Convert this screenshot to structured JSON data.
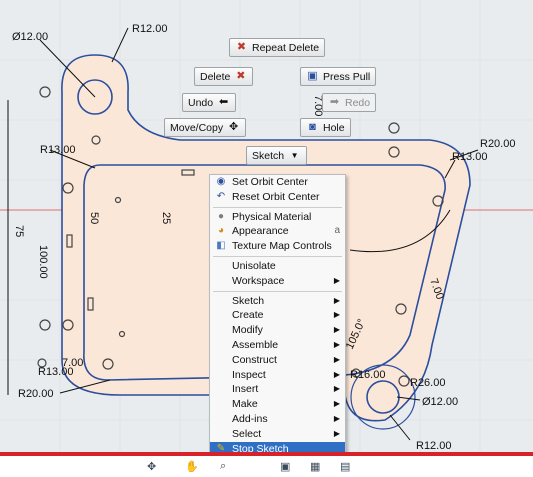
{
  "dimensions": {
    "d_top_circle": "Ø12.00",
    "r_top": "R12.00",
    "r_left_corner": "R13.00",
    "r_right_top": "R20.00",
    "r_right_corner": "R13.00",
    "dim_75": "75",
    "dim_50": "50",
    "dim_25": "25",
    "dim_7_right": "7.00",
    "dim_7_left": "7.00",
    "dim_7_top": "7.00",
    "r_bottom_left": "R13.00",
    "r_bottom_left_outer": "R20.00",
    "angle": "105.0°",
    "r_16": "R16.00",
    "r_26": "R26.00",
    "d_bottom_circle": "Ø12.00",
    "r_bottom": "R12.00",
    "dim_cut": "100.00"
  },
  "marking_menu": {
    "repeat_delete": "Repeat Delete",
    "delete": "Delete",
    "press_pull": "Press Pull",
    "undo": "Undo",
    "redo": "Redo",
    "move_copy": "Move/Copy",
    "hole": "Hole",
    "sketch": "Sketch"
  },
  "context_menu": {
    "groups": [
      [
        {
          "label": "Set Orbit Center",
          "icon": "orbit-center-icon"
        },
        {
          "label": "Reset Orbit Center",
          "icon": "reset-orbit-icon"
        }
      ],
      [
        {
          "label": "Physical Material",
          "icon": "material-sphere-icon"
        },
        {
          "label": "Appearance",
          "icon": "appearance-icon",
          "shortcut": "a"
        },
        {
          "label": "Texture Map Controls",
          "icon": "texture-map-icon"
        }
      ],
      [
        {
          "label": "Unisolate"
        },
        {
          "label": "Workspace",
          "submenu": true
        }
      ],
      [
        {
          "label": "Sketch",
          "submenu": true
        },
        {
          "label": "Create",
          "submenu": true
        },
        {
          "label": "Modify",
          "submenu": true
        },
        {
          "label": "Assemble",
          "submenu": true
        },
        {
          "label": "Construct",
          "submenu": true
        },
        {
          "label": "Inspect",
          "submenu": true
        },
        {
          "label": "Insert",
          "submenu": true
        },
        {
          "label": "Make",
          "submenu": true
        },
        {
          "label": "Add-ins",
          "submenu": true
        },
        {
          "label": "Select",
          "submenu": true
        },
        {
          "label": "Stop Sketch",
          "icon": "stop-sketch-icon",
          "active": true
        }
      ]
    ]
  },
  "colors": {
    "profile_fill": "#fbe7d8",
    "profile_stroke": "#2b4f9e",
    "menu_highlight": "#2f6fc4",
    "recording_bar": "#d8222a"
  }
}
